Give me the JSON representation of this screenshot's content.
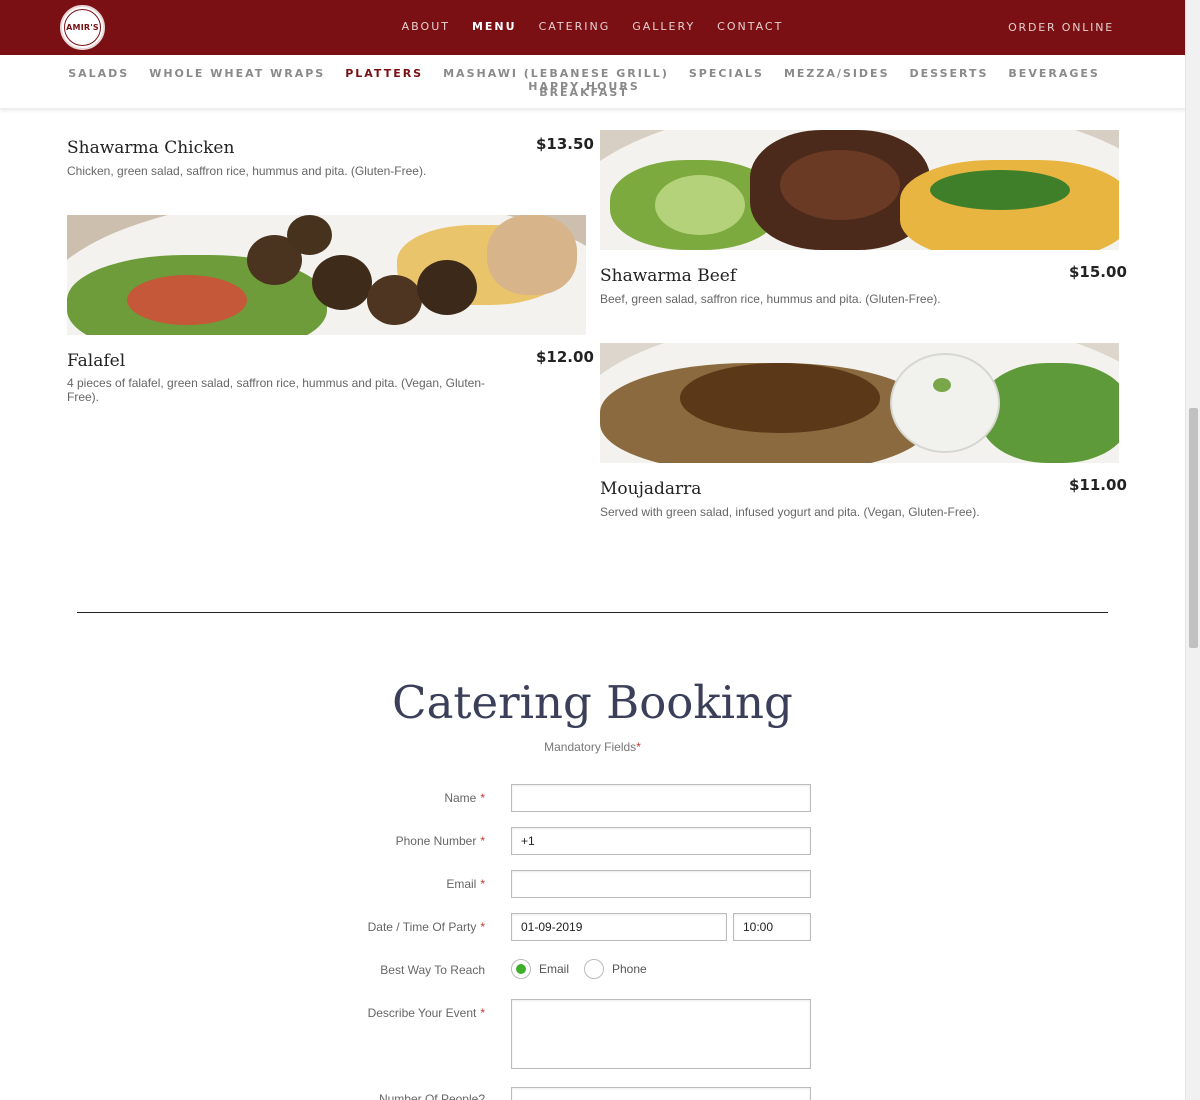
{
  "brand": {
    "logo_text": "AMIR'S"
  },
  "main_nav": {
    "items": [
      "ABOUT",
      "MENU",
      "CATERING",
      "GALLERY",
      "CONTACT"
    ],
    "active": "MENU",
    "order_online": "ORDER ONLINE"
  },
  "category_nav": {
    "row1": [
      "SALADS",
      "WHOLE WHEAT WRAPS",
      "PLATTERS",
      "MASHAWI (LEBANESE GRILL)",
      "SPECIALS",
      "MEZZA/SIDES",
      "DESSERTS",
      "BEVERAGES",
      "HAPPY HOURS"
    ],
    "row2": [
      "BREAKFAST"
    ],
    "active": "PLATTERS"
  },
  "menu_items": [
    {
      "title": "Shawarma Chicken",
      "price": "$13.50",
      "description": "Chicken, green salad, saffron rice, hummus and pita. (Gluten-Free)."
    },
    {
      "title": "Shawarma Beef",
      "price": "$15.00",
      "description": "Beef, green salad, saffron rice, hummus and pita. (Gluten-Free)."
    },
    {
      "title": "Falafel",
      "price": "$12.00",
      "description": "4 pieces of falafel, green salad, saffron rice, hummus and pita. (Vegan, Gluten-Free)."
    },
    {
      "title": "Moujadarra",
      "price": "$11.00",
      "description": "Served with green salad, infused yogurt and pita. (Vegan, Gluten-Free)."
    }
  ],
  "booking": {
    "title": "Catering Booking",
    "mandatory_text": "Mandatory Fields",
    "mandatory_star": "*",
    "fields": {
      "name_label": "Name",
      "name_value": "",
      "phone_label": "Phone Number",
      "phone_value": "+1",
      "email_label": "Email",
      "email_value": "",
      "date_label": "Date / Time Of Party",
      "date_value": "01-09-2019",
      "time_value": "10:00",
      "reach_label": "Best Way To Reach",
      "reach_options": [
        "Email",
        "Phone"
      ],
      "reach_selected": "Email",
      "describe_label": "Describe Your Event",
      "describe_value": "",
      "people_label": "Number Of People?"
    },
    "required_star": "*"
  },
  "colors": {
    "brand_red": "#7a1014",
    "title_navy": "#3c3f5a",
    "radio_green": "#3fae2a",
    "required_red": "#c0392b"
  }
}
